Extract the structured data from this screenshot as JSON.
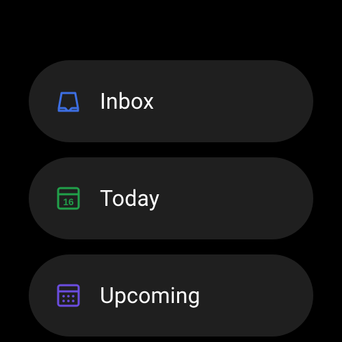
{
  "menu": {
    "items": [
      {
        "label": "Inbox",
        "icon": "inbox-icon",
        "iconColor": "#3D6FE3"
      },
      {
        "label": "Today",
        "icon": "calendar-today-icon",
        "iconColor": "#21A04A",
        "dayNumber": "16"
      },
      {
        "label": "Upcoming",
        "icon": "calendar-upcoming-icon",
        "iconColor": "#6B4DE0"
      }
    ]
  }
}
